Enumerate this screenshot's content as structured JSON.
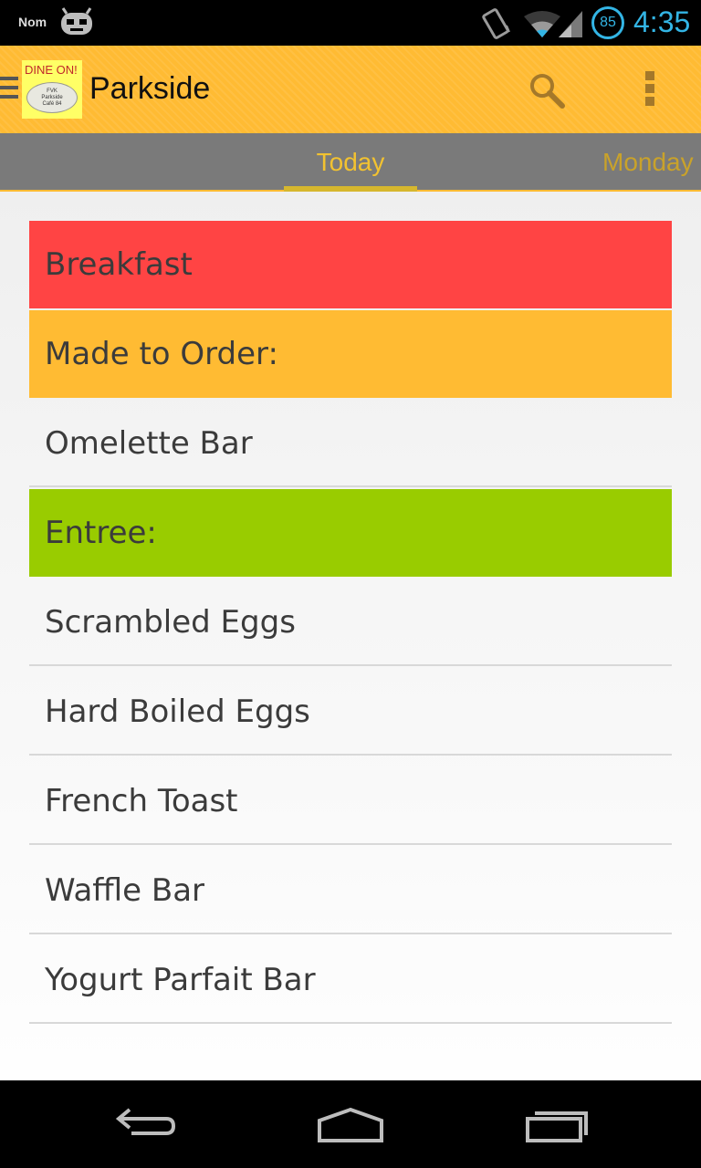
{
  "status_bar": {
    "app_label": "Nom",
    "battery_level": "85",
    "time": "4:35",
    "icons": [
      "cyanogen-notification-icon",
      "vibrate-icon",
      "wifi-icon",
      "signal-icon",
      "battery-icon"
    ],
    "accent_color": "#33b5e5"
  },
  "action_bar": {
    "logo": {
      "banner": "DINE ON!",
      "plate_text": "FVK\nParkside\nCafé 84"
    },
    "title": "Parkside",
    "background_color": "#ffbb33",
    "actions": [
      "search-icon",
      "overflow-menu-icon"
    ]
  },
  "tabs": [
    {
      "label": "Today",
      "selected": true
    },
    {
      "label": "Monday",
      "selected": false
    }
  ],
  "menu": {
    "rows": [
      {
        "label": "Breakfast",
        "kind": "meal-header",
        "color": "#ff4444"
      },
      {
        "label": "Made to Order:",
        "kind": "category-header",
        "color": "#ffbb33"
      },
      {
        "label": "Omelette Bar",
        "kind": "item"
      },
      {
        "label": "Entree:",
        "kind": "category-header",
        "color": "#99cc00"
      },
      {
        "label": "Scrambled Eggs",
        "kind": "item"
      },
      {
        "label": "Hard Boiled Eggs",
        "kind": "item"
      },
      {
        "label": "French Toast",
        "kind": "item"
      },
      {
        "label": "Waffle Bar",
        "kind": "item"
      },
      {
        "label": "Yogurt Parfait Bar",
        "kind": "item"
      }
    ]
  },
  "nav_bar": {
    "buttons": [
      "back-icon",
      "home-icon",
      "recent-apps-icon"
    ]
  }
}
